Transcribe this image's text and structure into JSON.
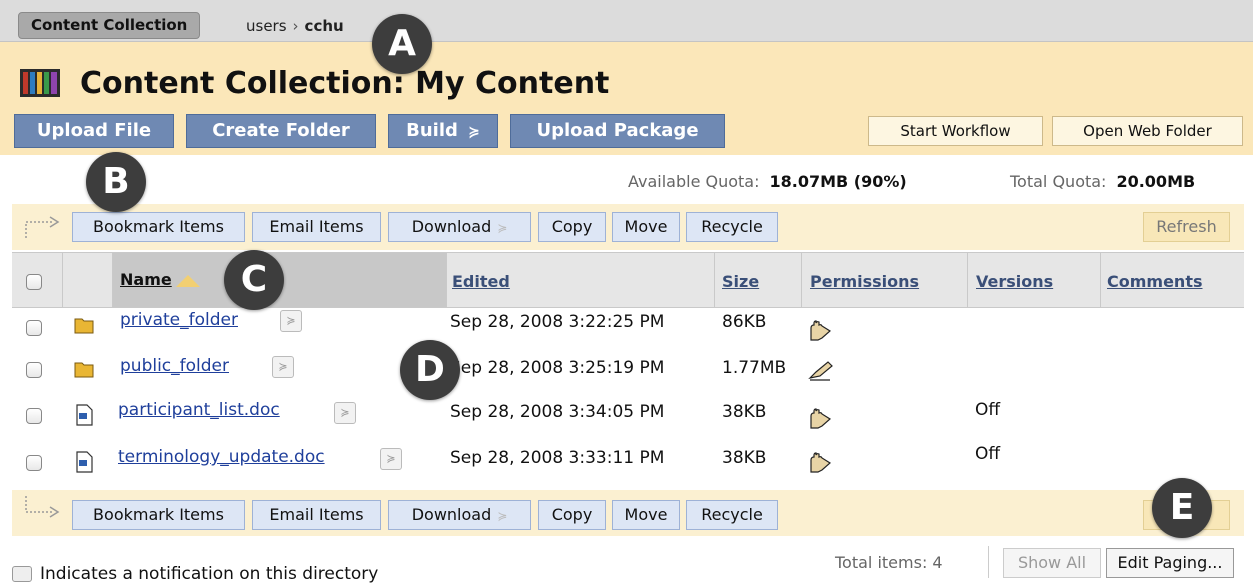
{
  "breadcrumb": {
    "tab_label": "Content Collection",
    "path": [
      "users",
      "cchu"
    ]
  },
  "header": {
    "title": "Content Collection: My Content",
    "buttons": {
      "upload_file": "Upload File",
      "create_folder": "Create Folder",
      "build": "Build",
      "upload_package": "Upload Package",
      "start_workflow": "Start Workflow",
      "open_web_folder": "Open Web Folder"
    }
  },
  "quota": {
    "available_label": "Available Quota:",
    "available_value": "18.07MB (90%)",
    "total_label": "Total Quota:",
    "total_value": "20.00MB"
  },
  "actions": {
    "bookmark": "Bookmark Items",
    "email": "Email Items",
    "download": "Download",
    "copy": "Copy",
    "move": "Move",
    "recycle": "Recycle",
    "refresh": "Refresh"
  },
  "table": {
    "columns": {
      "name": "Name",
      "edited": "Edited",
      "size": "Size",
      "permissions": "Permissions",
      "versions": "Versions",
      "comments": "Comments"
    },
    "rows": [
      {
        "name": "private_folder",
        "edited": "Sep 28, 2008 3:22:25 PM",
        "size": "86KB",
        "versions": "",
        "type": "folder",
        "permission_icon": "hand-icon"
      },
      {
        "name": "public_folder",
        "edited": "Sep 28, 2008 3:25:19 PM",
        "size": "1.77MB",
        "versions": "",
        "type": "folder",
        "permission_icon": "pencil-icon"
      },
      {
        "name": "participant_list.doc",
        "edited": "Sep 28, 2008 3:34:05 PM",
        "size": "38KB",
        "versions": "Off",
        "type": "doc",
        "permission_icon": "hand-icon"
      },
      {
        "name": "terminology_update.doc",
        "edited": "Sep 28, 2008 3:33:11 PM",
        "size": "38KB",
        "versions": "Off",
        "type": "doc",
        "permission_icon": "hand-icon"
      }
    ]
  },
  "footer": {
    "notification_note": "Indicates a notification on this directory",
    "total_items": "Total items: 4",
    "show_all": "Show All",
    "edit_paging": "Edit Paging..."
  },
  "callouts": [
    "A",
    "B",
    "C",
    "D",
    "E"
  ],
  "colors": {
    "header_bg": "#fbe7b9",
    "primary_button": "#6f89b3",
    "action_button": "#dde6f5",
    "link": "#1f3f9b",
    "callout": "#3d3d3d"
  }
}
